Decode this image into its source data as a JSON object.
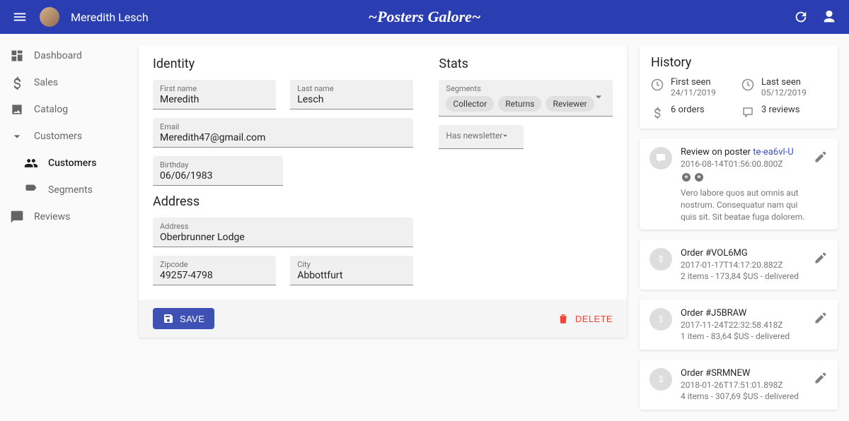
{
  "appbar": {
    "username": "Meredith Lesch",
    "brand": "~Posters Galore~"
  },
  "sidebar": {
    "dashboard": "Dashboard",
    "sales": "Sales",
    "catalog": "Catalog",
    "customers": "Customers",
    "customers_list": "Customers",
    "segments": "Segments",
    "reviews": "Reviews"
  },
  "form": {
    "identity_title": "Identity",
    "address_title": "Address",
    "stats_title": "Stats",
    "labels": {
      "first_name": "First name",
      "last_name": "Last name",
      "email": "Email",
      "birthday": "Birthday",
      "address": "Address",
      "zipcode": "Zipcode",
      "city": "City",
      "segments": "Segments",
      "newsletter": "Has newsletter"
    },
    "values": {
      "first_name": "Meredith",
      "last_name": "Lesch",
      "email": "Meredith47@gmail.com",
      "birthday": "06/06/1983",
      "address": "Oberbrunner Lodge",
      "zipcode": "49257-4798",
      "city": "Abbottfurt"
    },
    "segments": [
      "Collector",
      "Returns",
      "Reviewer"
    ],
    "save_label": "SAVE",
    "delete_label": "DELETE"
  },
  "history": {
    "title": "History",
    "first_seen_label": "First seen",
    "first_seen_value": "24/11/2019",
    "last_seen_label": "Last seen",
    "last_seen_value": "05/12/2019",
    "orders_count": "6 orders",
    "reviews_count": "3 reviews"
  },
  "events": [
    {
      "kind": "review",
      "title_prefix": "Review on poster ",
      "link": "te-ea6vl-U",
      "time": "2016-08-14T01:56:00.800Z",
      "stars": 2,
      "text": "Vero labore quos aut omnis aut nostrum. Consequatur nam qui quis sit. Sit beatae fuga dolorem. Fugit omnis…"
    },
    {
      "kind": "order",
      "title": "Order #VOL6MG",
      "time": "2017-01-17T14:17:20.882Z",
      "meta": "2 items - 173,84 $US - delivered"
    },
    {
      "kind": "order",
      "title": "Order #J5BRAW",
      "time": "2017-11-24T22:32:58.418Z",
      "meta": "1 item - 83,64 $US - delivered"
    },
    {
      "kind": "order",
      "title": "Order #SRMNEW",
      "time": "2018-01-26T17:51:01.898Z",
      "meta": "4 items - 307,69 $US - delivered"
    }
  ]
}
